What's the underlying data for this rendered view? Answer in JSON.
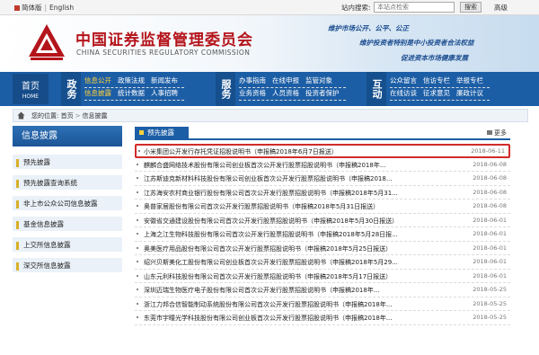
{
  "topbar": {
    "lang_cn": "简体版",
    "lang_en": "English",
    "search_label": "站内搜索:",
    "search_placeholder": "本站点检索",
    "search_button": "搜索",
    "advanced": "高级"
  },
  "banner": {
    "title_cn": "中国证券监督管理委员会",
    "title_en": "CHINA SECURITIES REGULATORY COMMISSION",
    "slogan1": "维护市场公开、公平、公正",
    "slogan2": "维护投资者特别是中小投资者合法权益",
    "slogan3": "促进资本市场健康发展"
  },
  "nav": {
    "home_cn": "首页",
    "home_en": "HOME",
    "sections": [
      {
        "label": "政务",
        "rows": [
          [
            "信息公开",
            "政策法规",
            "新闻发布"
          ],
          [
            "信息披露",
            "统计数据",
            "人事招聘"
          ]
        ]
      },
      {
        "label": "服务",
        "rows": [
          [
            "办事指南",
            "在线申报",
            "监管对象"
          ],
          [
            "业务资格",
            "人员资格",
            "投资者保护"
          ]
        ]
      },
      {
        "label": "互动",
        "rows": [
          [
            "公众留言",
            "信访专栏",
            "举报专栏"
          ],
          [
            "在线访谈",
            "征求意见",
            "廉政计议"
          ]
        ]
      }
    ]
  },
  "breadcrumb": {
    "prefix": "您的位置:",
    "home": "首页",
    "current": "信息披露"
  },
  "sidebar": {
    "title": "信息披露",
    "items": [
      {
        "label": "预先披露"
      },
      {
        "label": "预先披露查询系统"
      },
      {
        "label": "非上市公众公司信息披露"
      },
      {
        "label": "基金信息披露"
      },
      {
        "label": "上交所信息披露"
      },
      {
        "label": "深交所信息披露"
      }
    ]
  },
  "content": {
    "tab": "预先披露",
    "more": "更多",
    "rows": [
      {
        "title": "小米集团公开发行存托凭证招股说明书（申报稿2018年6月7日报送）",
        "date": "2018-06-11",
        "highlight": true
      },
      {
        "title": "麒麟合盛网络技术股份有限公司创业板首次公开发行股票招股说明书（申报稿2018年...",
        "date": "2018-06-08"
      },
      {
        "title": "江苏斯迪克新材料科技股份有限公司创业板首次公开发行股票招股说明书（申报稿2018...",
        "date": "2018-06-08"
      },
      {
        "title": "江苏海安农村商业银行股份有限公司首次公开发行股票招股说明书（申报稿2018年5月31...",
        "date": "2018-06-08"
      },
      {
        "title": "奥普家居股份有限公司首次公开发行股票招股说明书（申报稿2018年5月31日报送）",
        "date": "2018-06-08"
      },
      {
        "title": "安徽省交通建设股份有限公司首次公开发行股票招股说明书（申报稿2018年5月30日报送）",
        "date": "2018-06-01"
      },
      {
        "title": "上海之江生物科技股份有限公司首次公开发行股票招股说明书（申报稿2018年5月28日报...",
        "date": "2018-06-01"
      },
      {
        "title": "奥美医疗用品股份有限公司首次公开发行股票招股说明书（申报稿2018年5月25日报送）",
        "date": "2018-06-01"
      },
      {
        "title": "绍兴贝斯美化工股份有限公司创业板首次公开发行股票招股说明书（申报稿2018年5月29...",
        "date": "2018-06-01"
      },
      {
        "title": "山东元利科技股份有限公司首次公开发行股票招股说明书（申报稿2018年5月17日报送）",
        "date": "2018-06-01"
      },
      {
        "title": "深圳迈瑞生物医疗电子股份有限公司首次公开发行股票招股说明书（申报稿2018年...",
        "date": "2018-05-25"
      },
      {
        "title": "浙江力邦合信智能制动系统股份有限公司首次公开发行股票招股说明书（申报稿2018年...",
        "date": "2018-05-25"
      },
      {
        "title": "东莞市宇瞳光学科技股份有限公司创业板首次公开发行股票招股说明书（申报稿2018年...",
        "date": "2018-05-25"
      }
    ]
  },
  "colors": {
    "brand_red": "#b4141b",
    "nav_blue": "#1c5ea6",
    "highlight_red": "#d22b2b"
  }
}
